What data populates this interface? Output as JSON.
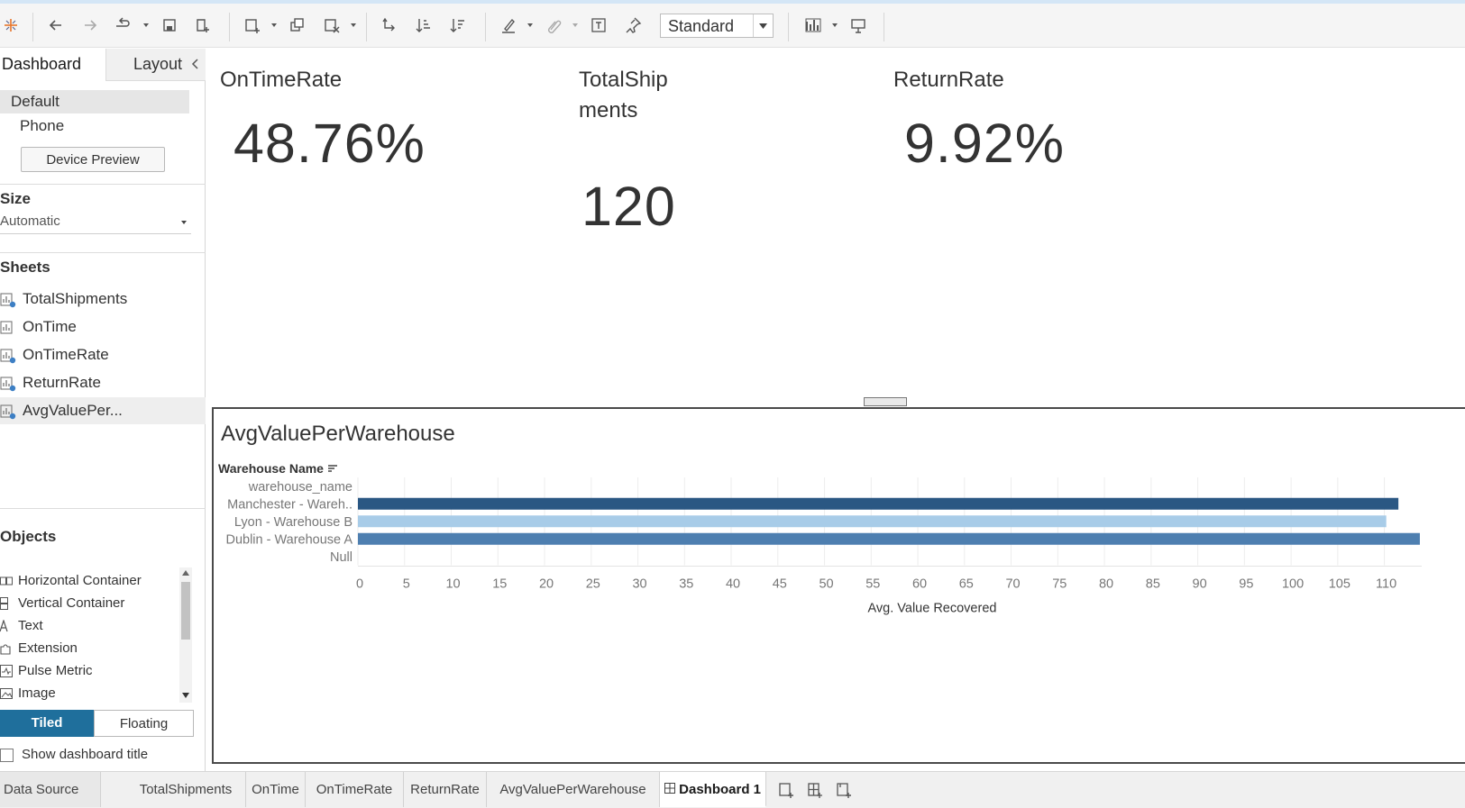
{
  "toolbar": {
    "mark_size_select": "Standard"
  },
  "left_pane": {
    "tabs": [
      "Dashboard",
      "Layout"
    ],
    "device_options": [
      "Default",
      "Phone"
    ],
    "device_preview_label": "Device Preview",
    "size_title": "Size",
    "size_value": "Automatic",
    "sheets_title": "Sheets",
    "sheets": [
      "TotalShipments",
      "OnTime",
      "OnTimeRate",
      "ReturnRate",
      "AvgValuePer..."
    ],
    "objects_title": "Objects",
    "objects": [
      "Horizontal Container",
      "Vertical Container",
      "Text",
      "Extension",
      "Pulse Metric",
      "Image"
    ],
    "tiled_label": "Tiled",
    "floating_label": "Floating",
    "show_title_label": "Show dashboard title"
  },
  "kpis": [
    {
      "title": "OnTimeRate",
      "value": "48.76%"
    },
    {
      "title_line1": "TotalShip",
      "title_line2": "ments",
      "value": "120"
    },
    {
      "title": "ReturnRate",
      "value": "9.92%"
    }
  ],
  "chart_panel": {
    "title": "AvgValuePerWarehouse",
    "row_header": "Warehouse Name"
  },
  "chart_data": {
    "type": "bar",
    "orientation": "horizontal",
    "title": "AvgValuePerWarehouse",
    "ylabel": "Warehouse Name",
    "xlabel": "Avg. Value Recovered",
    "categories": [
      "warehouse_name",
      "Manchester - Wareh..",
      "Lyon - Warehouse B",
      "Dublin - Warehouse A",
      "Null"
    ],
    "values": [
      null,
      111.5,
      110.2,
      113.8,
      null
    ],
    "colors": [
      "#2a5783",
      "#a8cce8",
      "#4e7fb0"
    ],
    "xlim": [
      0,
      114
    ],
    "xticks": [
      0,
      5,
      10,
      15,
      20,
      25,
      30,
      35,
      40,
      45,
      50,
      55,
      60,
      65,
      70,
      75,
      80,
      85,
      90,
      95,
      100,
      105,
      110
    ],
    "grid": true
  },
  "bottom_tabs": {
    "data_source": "Data Source",
    "sheets": [
      "TotalShipments",
      "OnTime",
      "OnTimeRate",
      "ReturnRate",
      "AvgValuePerWarehouse"
    ],
    "active": "Dashboard 1"
  }
}
